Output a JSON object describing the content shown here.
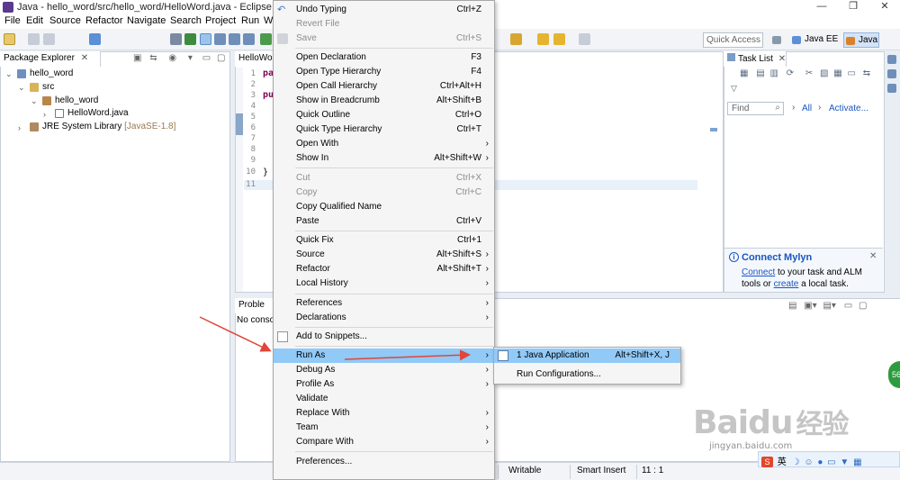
{
  "window": {
    "title": "Java - hello_word/src/hello_word/HelloWord.java - Eclipse",
    "minimize": "—",
    "maximize": "❐",
    "close": "✕"
  },
  "menubar": [
    "File",
    "Edit",
    "Source",
    "Refactor",
    "Navigate",
    "Search",
    "Project",
    "Run",
    "W"
  ],
  "toolbar": {
    "quick_access_placeholder": "Quick Access",
    "perspectives": [
      "Java EE",
      "Java"
    ]
  },
  "package_explorer": {
    "tab": "Package Explorer",
    "tree": [
      {
        "label": "hello_word",
        "twisty": "⌄"
      },
      {
        "label": "src",
        "twisty": "⌄"
      },
      {
        "label": "hello_word",
        "twisty": "⌄"
      },
      {
        "label": "HelloWord.java",
        "twisty": "›"
      },
      {
        "label": "JRE System Library",
        "extra": "[JavaSE-1.8]",
        "twisty": "›"
      }
    ]
  },
  "editor": {
    "tab": "HelloWo",
    "line_numbers": [
      "1",
      "2",
      "3",
      "4",
      "5",
      "6",
      "7",
      "8",
      "9",
      "10",
      "11"
    ],
    "code_fragments": [
      "pa",
      "pu",
      "}"
    ]
  },
  "context_menu": {
    "items": [
      {
        "label": "Undo Typing",
        "shortcut": "Ctrl+Z"
      },
      {
        "label": "Revert File",
        "shortcut": "",
        "disabled": true
      },
      {
        "label": "Save",
        "shortcut": "Ctrl+S",
        "disabled": true
      },
      {
        "label": "Open Declaration",
        "shortcut": "F3"
      },
      {
        "label": "Open Type Hierarchy",
        "shortcut": "F4"
      },
      {
        "label": "Open Call Hierarchy",
        "shortcut": "Ctrl+Alt+H"
      },
      {
        "label": "Show in Breadcrumb",
        "shortcut": "Alt+Shift+B"
      },
      {
        "label": "Quick Outline",
        "shortcut": "Ctrl+O"
      },
      {
        "label": "Quick Type Hierarchy",
        "shortcut": "Ctrl+T"
      },
      {
        "label": "Open With",
        "shortcut": ""
      },
      {
        "label": "Show In",
        "shortcut": "Alt+Shift+W"
      },
      {
        "label": "Cut",
        "shortcut": "Ctrl+X",
        "disabled": true
      },
      {
        "label": "Copy",
        "shortcut": "Ctrl+C",
        "disabled": true
      },
      {
        "label": "Copy Qualified Name",
        "shortcut": ""
      },
      {
        "label": "Paste",
        "shortcut": "Ctrl+V"
      },
      {
        "label": "Quick Fix",
        "shortcut": "Ctrl+1"
      },
      {
        "label": "Source",
        "shortcut": "Alt+Shift+S"
      },
      {
        "label": "Refactor",
        "shortcut": "Alt+Shift+T"
      },
      {
        "label": "Local History",
        "shortcut": ""
      },
      {
        "label": "References",
        "shortcut": ""
      },
      {
        "label": "Declarations",
        "shortcut": ""
      },
      {
        "label": "Add to Snippets...",
        "shortcut": ""
      },
      {
        "label": "Run As",
        "shortcut": ""
      },
      {
        "label": "Debug As",
        "shortcut": ""
      },
      {
        "label": "Profile As",
        "shortcut": ""
      },
      {
        "label": "Validate",
        "shortcut": ""
      },
      {
        "label": "Replace With",
        "shortcut": ""
      },
      {
        "label": "Team",
        "shortcut": ""
      },
      {
        "label": "Compare With",
        "shortcut": ""
      },
      {
        "label": "Preferences...",
        "shortcut": ""
      }
    ]
  },
  "submenu": {
    "items": [
      {
        "label": "1 Java Application",
        "shortcut": "Alt+Shift+X, J"
      },
      {
        "label": "Run Configurations..."
      }
    ]
  },
  "task_list": {
    "tab": "Task List",
    "find_placeholder": "Find",
    "all": "All",
    "activate": "Activate..."
  },
  "mylyn": {
    "title": "Connect Mylyn",
    "line1_link": "Connect",
    "line1_rest": " to your task and ALM",
    "line2_pre": "tools or ",
    "line2_link": "create",
    "line2_post": " a local task."
  },
  "problems": {
    "tab": "Proble",
    "text": "No conso"
  },
  "status": {
    "writable": "Writable",
    "insert": "Smart Insert",
    "position": "11 : 1"
  },
  "watermark": {
    "brand": "Baidu",
    "cn": "经验",
    "url": "jingyan.baidu.com"
  },
  "tray": {
    "ime": "英"
  },
  "colors": {
    "menu_highlight": "#91c9f7",
    "annotation_arrow": "#e0463a",
    "link": "#1a55c0"
  }
}
